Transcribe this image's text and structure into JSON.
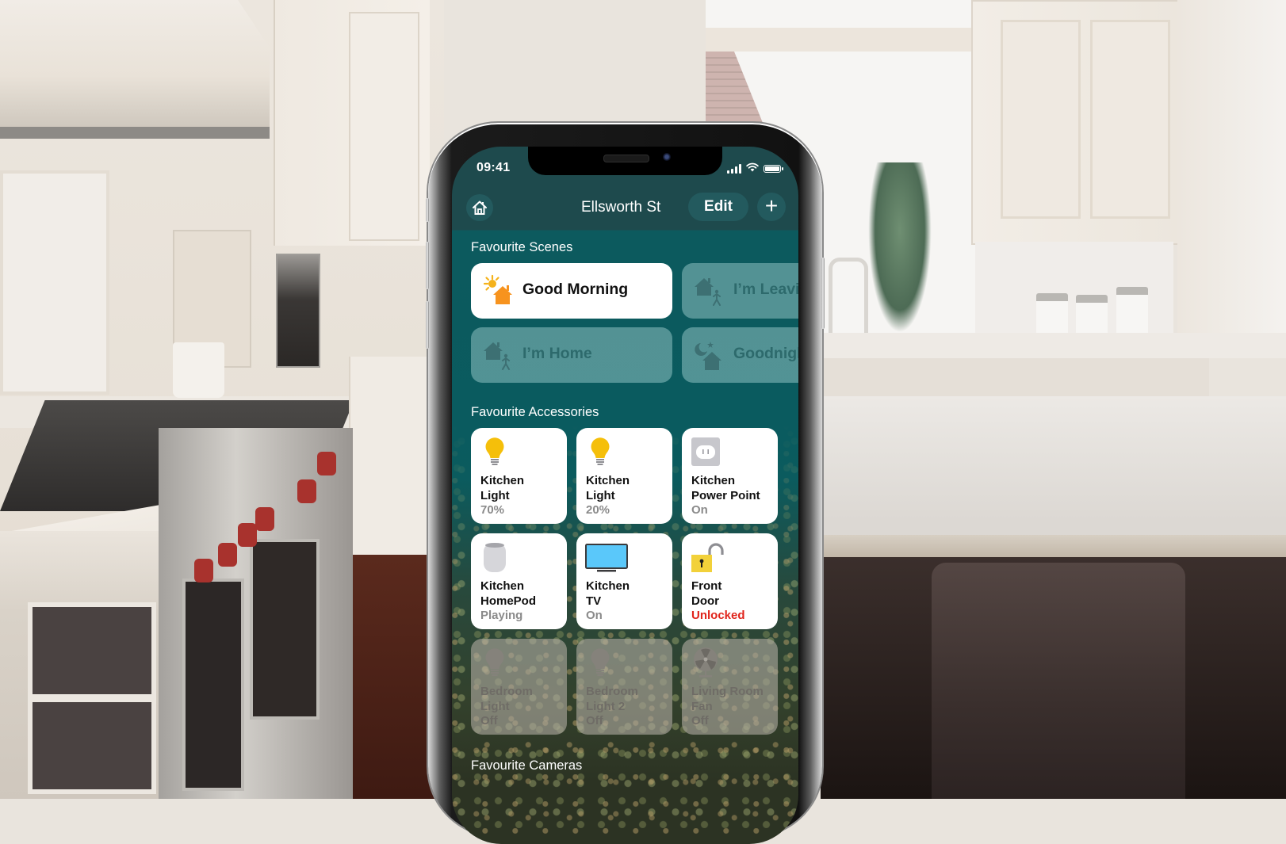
{
  "status_bar": {
    "time": "09:41",
    "signal_icon": "cellular-signal-icon",
    "wifi_icon": "wifi-icon",
    "battery_icon": "battery-icon"
  },
  "nav": {
    "home_icon": "home-icon",
    "title": "Ellsworth St",
    "edit_label": "Edit",
    "add_label": "+"
  },
  "scenes": {
    "title": "Favourite Scenes",
    "items": [
      {
        "label": "Good Morning",
        "icon": "sun-house-icon",
        "active": true
      },
      {
        "label": "I’m Leaving",
        "icon": "house-walking-person-icon",
        "active": false
      },
      {
        "label": "I’m Home",
        "icon": "house-walking-person-icon",
        "active": false
      },
      {
        "label": "Goodnight",
        "icon": "moon-house-icon",
        "active": false
      }
    ]
  },
  "accessories": {
    "title": "Favourite Accessories",
    "items": [
      {
        "name": "Kitchen\nLight",
        "status": "70%",
        "icon": "lightbulb-icon",
        "on": true,
        "brightness_percent": 70
      },
      {
        "name": "Kitchen\nLight",
        "status": "20%",
        "icon": "lightbulb-icon",
        "on": true,
        "brightness_percent": 20
      },
      {
        "name": "Kitchen\nPower Point",
        "status": "On",
        "icon": "power-outlet-icon",
        "on": true
      },
      {
        "name": "Kitchen\nHomePod",
        "status": "Playing",
        "icon": "homepod-icon",
        "on": true
      },
      {
        "name": "Kitchen\nTV",
        "status": "On",
        "icon": "tv-icon",
        "on": true
      },
      {
        "name": "Front\nDoor",
        "status": "Unlocked",
        "icon": "unlocked-padlock-icon",
        "on": true,
        "alert": true
      },
      {
        "name": "Bedroom\nLight",
        "status": "Off",
        "icon": "lightbulb-icon",
        "on": false
      },
      {
        "name": "Bedroom\nLight 2",
        "status": "Off",
        "icon": "lightbulb-icon",
        "on": false
      },
      {
        "name": "Living Room\nFan",
        "status": "Off",
        "icon": "fan-icon",
        "on": false
      }
    ]
  },
  "cameras": {
    "title": "Favourite Cameras"
  },
  "colors": {
    "header_teal": "#1e4a4d",
    "body_teal": "#0a5b5f",
    "bulb_yellow": "#f5bf0a",
    "scene_orange": "#f7931e",
    "alert_red": "#e0241b",
    "tv_blue": "#5ac8fa",
    "lock_yellow": "#f2d13a"
  }
}
